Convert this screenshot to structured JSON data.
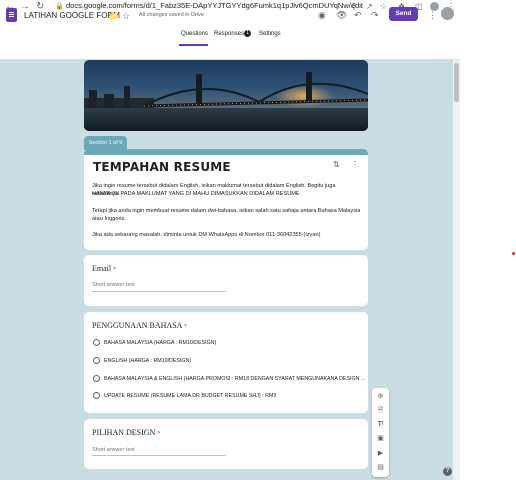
{
  "browser": {
    "url": "docs.google.com/forms/d/1_Fabz35E-DApYYJTGYYdg6Fumk1q1pJlv6QcmDUYqNw/edit",
    "nav_back_icon": "back-arrow-icon",
    "nav_forward_icon": "forward-arrow-icon",
    "reload_icon": "reload-icon"
  },
  "header": {
    "doc_title": "LATIHAN GOOGLE FORM",
    "save_status": "All changes saved in Drive",
    "send_label": "Send",
    "accent_color": "#673ab7"
  },
  "tabs": [
    {
      "label": "Questions",
      "active": true
    },
    {
      "label": "Responses",
      "badge": "1"
    },
    {
      "label": "Settings"
    }
  ],
  "section": {
    "label": "Section 1 of 9",
    "color": "#6aa9b5"
  },
  "form": {
    "title": "TEMPAHAN RESUME",
    "description_1": "Jika ingin resume tersebut didalam English, isikan maklumat tersebut didalam English. Begitu juga sebaliknya.",
    "description_2": "HANYA ISI PADA MAKLUMAT YANG DI MAHU DIMASUKKAN DIDALAM RESUME",
    "description_3": "Tetapi jika anda ingin membuat resume dalam dwi-bahasa, isikan salah satu sahaja antara Bahasa Malaysia atau Inggeris.",
    "description_4": "Jika ada sebarang masalah, diminta untuk DM WhatsApps di Nombor 011-36042355 (Izyan)"
  },
  "questions": [
    {
      "title": "Email",
      "required": "*",
      "placeholder": "Short answer text"
    },
    {
      "title": "PENGGUNAAN BAHASA",
      "required": "*",
      "options": [
        "BAHASA MALAYSIA (HARGA : RM10/DESIGN)",
        "ENGLISH (HARGA : RM10/DESIGN)",
        "BAHASA MALAYSIA & ENGLISH (HARGA PROMOSI : RM18 DENGAN SYARAT MENGUNAKANA DESIGN ...",
        "UPDATE RESUME (RESUME LAMA DR BUDGET RESUME SHJ) : RM3"
      ]
    },
    {
      "title": "PILIHAN DESIGN",
      "required": "*",
      "placeholder": "Short answer text"
    }
  ],
  "side_toolbar": [
    "add-question-icon",
    "import-questions-icon",
    "add-title-icon",
    "add-image-icon",
    "add-video-icon",
    "add-section-icon"
  ],
  "help_label": "?"
}
